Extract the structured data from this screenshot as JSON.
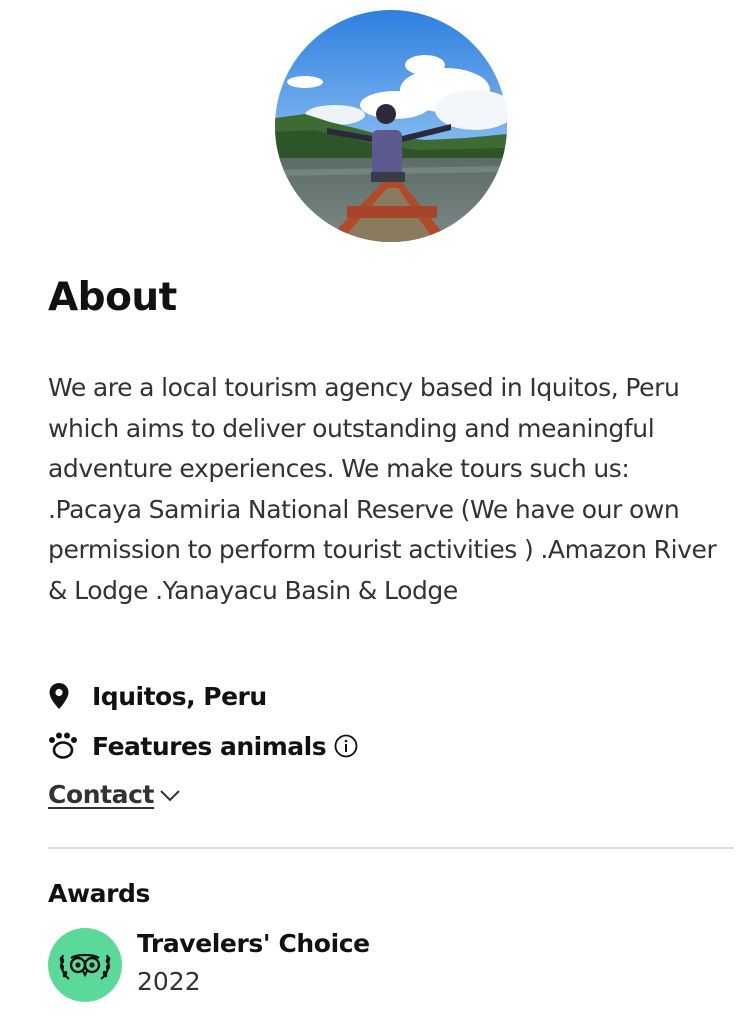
{
  "profile": {
    "avatar_icon": "profile-photo"
  },
  "about": {
    "title": "About",
    "description": "We are a local tourism agency based in Iquitos, Peru which aims to deliver outstanding and meaningful adventure experiences. We make tours such us: .Pacaya Samiria National Reserve (We have our own permission to perform tourist activities ) .Amazon River & Lodge .Yanayacu Basin & Lodge",
    "location": {
      "icon": "map-pin-icon",
      "text": "Iquitos, Peru"
    },
    "features": {
      "icon": "paw-icon",
      "text": "Features animals",
      "info_icon": "info-icon"
    },
    "contact": {
      "label": "Contact",
      "icon": "chevron-down-icon"
    }
  },
  "awards": {
    "title": "Awards",
    "items": [
      {
        "icon": "travelers-choice-owl-icon",
        "name": "Travelers' Choice",
        "year": "2022",
        "badge_color": "#5bd99b"
      }
    ]
  }
}
